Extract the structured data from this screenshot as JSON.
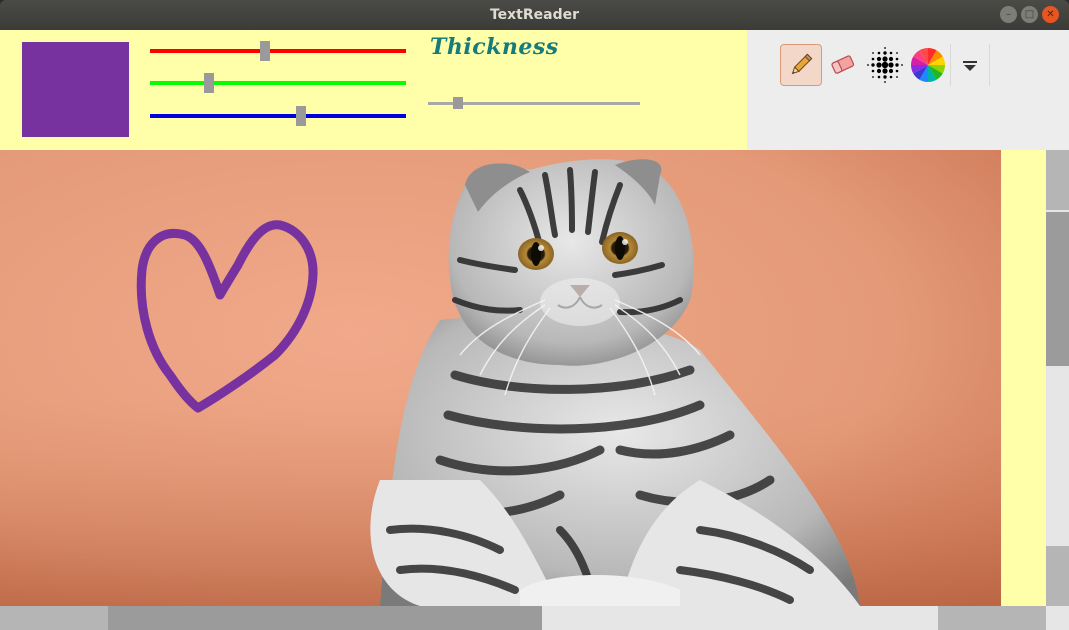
{
  "window": {
    "title": "TextReader"
  },
  "window_buttons": {
    "minimize": "–",
    "maximize": "□",
    "close": "✕"
  },
  "color": {
    "current_hex": "#7732a0",
    "red_value": 0.45,
    "green_value": 0.23,
    "blue_value": 0.59
  },
  "thickness": {
    "label": "Thickness",
    "value": 0.14
  },
  "tools": {
    "pencil": {
      "icon": "pencil-icon",
      "active": true
    },
    "eraser": {
      "icon": "eraser-icon",
      "active": false
    },
    "dots": {
      "icon": "dot-pattern-icon",
      "active": false
    },
    "palette": {
      "icon": "color-wheel-icon",
      "active": false
    },
    "menu": {
      "icon": "dropdown-arrow-icon",
      "active": false
    }
  },
  "canvas": {
    "image": "cat-photo",
    "drawing": "heart-sketch",
    "stroke_color": "#7732a0"
  },
  "colors": {
    "toolbar_bg": "#ffffaa",
    "slider_red": "#ff0000",
    "slider_green": "#00ff00",
    "slider_blue": "#0000dd",
    "label_color": "#177b7b"
  }
}
